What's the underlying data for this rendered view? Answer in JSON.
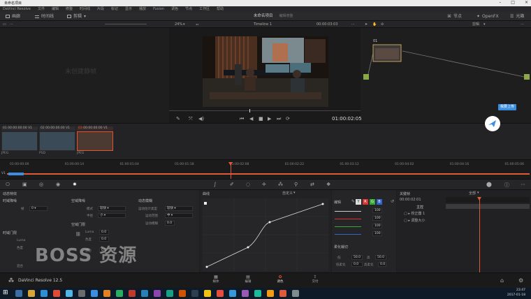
{
  "window": {
    "title": "未命名项目"
  },
  "menu": [
    "DaVinci Resolve",
    "文件",
    "编辑",
    "修整",
    "时间线",
    "片段",
    "标记",
    "显示",
    "播放",
    "Fusion",
    "调色",
    "节点",
    "工作区",
    "帮助"
  ],
  "toolbar": {
    "gallery": "画廊",
    "timelines": "时间线",
    "clips": "剪辑",
    "project_name": "未命名项目",
    "project_status": "编辑修整",
    "nodes": "节点",
    "openfx": "OpenFX",
    "lightbox": "光箱"
  },
  "viewer": {
    "zoom": "24%",
    "timeline_name": "Timeline 1",
    "source_tc": "00:00:03:03",
    "current_tc": "01:00:02:05",
    "node_mode": "剪辑"
  },
  "gallery": {
    "watermark": "未创建静帧"
  },
  "clips": [
    {
      "index": "01",
      "tc": "00:00:00:00",
      "track": "V1",
      "label": "JPEG"
    },
    {
      "index": "02",
      "tc": "00:00:00:00",
      "track": "V1",
      "label": "PSD"
    },
    {
      "index": "03",
      "tc": "00:00:00:00",
      "track": "V1",
      "label": "JPEG"
    }
  ],
  "timeline": {
    "ticks": [
      "01:00:00:00",
      "01:00:00:14",
      "01:00:01:04",
      "01:00:01:18",
      "01:00:02:08",
      "01:00:02:22",
      "01:00:03:12",
      "01:00:04:02",
      "01:00:04:16",
      "01:00:05:06"
    ],
    "track": "V1"
  },
  "motion": {
    "title": "动态特效",
    "spatial_nr": "时域降噪",
    "frames_label": "帧",
    "frames_value": "0",
    "temporal_threshold": "时域门限",
    "luma": "Luma",
    "chroma": "色度",
    "blend": "混合"
  },
  "spatial": {
    "title": "空域降噪",
    "mode_label": "模式",
    "mode_value": "较快",
    "radius_label": "半径",
    "radius_value": "小",
    "threshold_title": "空域门限",
    "luma": "Luma",
    "luma_value": "0.0",
    "chroma": "色度",
    "chroma_value": "0.0",
    "blend": "混合",
    "blend_value": "0.0"
  },
  "blur": {
    "title": "动态模糊",
    "estimate_label": "运动估计类型",
    "estimate_value": "较快",
    "range_label": "运动范围",
    "range_value": "中",
    "amount_label": "运动模糊",
    "amount_value": "0.0"
  },
  "curves": {
    "title": "曲线",
    "mode": "自定义"
  },
  "edit": {
    "title": "编辑",
    "channels": [
      "Y",
      "R",
      "G",
      "B"
    ],
    "values": [
      "100",
      "100",
      "100",
      "100"
    ],
    "soft_clip": "柔化裁切",
    "low": "低",
    "low_value": "50.0",
    "high": "高",
    "high_value": "50.0",
    "low_soft": "低柔化",
    "low_soft_value": "0.0",
    "high_soft": "高柔化",
    "high_soft_value": "0.0"
  },
  "keyframes": {
    "title": "关键帧",
    "filter": "全部",
    "tc": "00:00:02:01",
    "rows": [
      "主控",
      "校正器 1",
      "调整大小"
    ]
  },
  "bottom": {
    "app": "DaVinci Resolve 12.5",
    "tabs": [
      "媒体",
      "编辑",
      "调色",
      "交付"
    ]
  },
  "upload": {
    "label": "我要上传"
  },
  "brand_watermark": "BOSS 资源",
  "taskbar": {
    "time": "23:47",
    "date": "2017-01-18"
  },
  "colors": {
    "accent": "#e8532d",
    "playhead": "#e05a3a",
    "blue": "#3b8fe0"
  }
}
